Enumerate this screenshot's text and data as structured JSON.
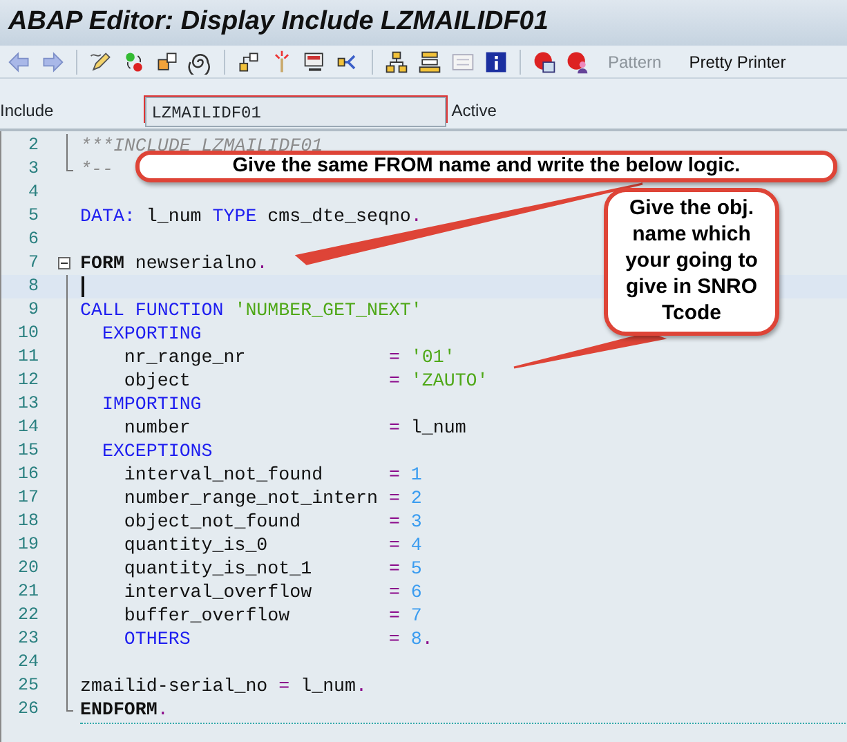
{
  "window": {
    "title": "ABAP Editor: Display Include LZMAILIDF01"
  },
  "toolbar": {
    "buttons": [
      {
        "label": "Pattern",
        "disabled": true
      },
      {
        "label": "Pretty Printer",
        "disabled": false
      }
    ]
  },
  "header": {
    "include_label": "Include",
    "include_value": "LZMAILIDF01",
    "status": "Active"
  },
  "editor": {
    "lines": [
      {
        "number": "2",
        "kind": "inner",
        "tokens": [
          {
            "kind": "comment",
            "text": "***INCLUDE LZMAILIDF01"
          }
        ]
      },
      {
        "number": "3",
        "kind": "end",
        "tokens": [
          {
            "kind": "comment",
            "text": "*--"
          }
        ]
      },
      {
        "number": "4",
        "kind": "plain"
      },
      {
        "number": "5",
        "kind": "plain",
        "tokens": [
          {
            "kind": "keyword",
            "text": "DATA:"
          },
          {
            "kind": "plain",
            "text": " l_num "
          },
          {
            "kind": "keyword",
            "text": "TYPE"
          },
          {
            "kind": "plain",
            "text": " cms_dte_seqno"
          },
          {
            "kind": "operator",
            "text": "."
          }
        ]
      },
      {
        "number": "6",
        "kind": "plain"
      },
      {
        "number": "7",
        "kind": "start",
        "tokens": [
          {
            "kind": "statement",
            "text": "FORM"
          },
          {
            "kind": "plain",
            "text": " newserialno"
          },
          {
            "kind": "operator",
            "text": "."
          }
        ]
      },
      {
        "number": "8",
        "kind": "inner",
        "current": true
      },
      {
        "number": "9",
        "kind": "inner",
        "tokens": [
          {
            "kind": "keyword",
            "text": "CALL FUNCTION"
          },
          {
            "kind": "string",
            "text": " 'NUMBER_GET_NEXT'"
          }
        ]
      },
      {
        "number": "10",
        "kind": "inner",
        "tokens": [
          {
            "kind": "keyword",
            "text": "  EXPORTING"
          }
        ]
      },
      {
        "number": "11",
        "kind": "inner",
        "tokens": [
          {
            "kind": "plain",
            "text": "    nr_range_nr             "
          },
          {
            "kind": "operator",
            "text": "="
          },
          {
            "kind": "string",
            "text": " '01'"
          }
        ]
      },
      {
        "number": "12",
        "kind": "inner",
        "tokens": [
          {
            "kind": "plain",
            "text": "    object                  "
          },
          {
            "kind": "operator",
            "text": "="
          },
          {
            "kind": "string",
            "text": " 'ZAUTO'"
          }
        ]
      },
      {
        "number": "13",
        "kind": "inner",
        "tokens": [
          {
            "kind": "keyword",
            "text": "  IMPORTING"
          }
        ]
      },
      {
        "number": "14",
        "kind": "inner",
        "tokens": [
          {
            "kind": "plain",
            "text": "    number                  "
          },
          {
            "kind": "operator",
            "text": "="
          },
          {
            "kind": "plain",
            "text": " l_num"
          }
        ]
      },
      {
        "number": "15",
        "kind": "inner",
        "tokens": [
          {
            "kind": "keyword",
            "text": "  EXCEPTIONS"
          }
        ]
      },
      {
        "number": "16",
        "kind": "inner",
        "tokens": [
          {
            "kind": "plain",
            "text": "    interval_not_found      "
          },
          {
            "kind": "operator",
            "text": "="
          },
          {
            "kind": "number",
            "text": " 1"
          }
        ]
      },
      {
        "number": "17",
        "kind": "inner",
        "tokens": [
          {
            "kind": "plain",
            "text": "    number_range_not_intern "
          },
          {
            "kind": "operator",
            "text": "="
          },
          {
            "kind": "number",
            "text": " 2"
          }
        ]
      },
      {
        "number": "18",
        "kind": "inner",
        "tokens": [
          {
            "kind": "plain",
            "text": "    object_not_found        "
          },
          {
            "kind": "operator",
            "text": "="
          },
          {
            "kind": "number",
            "text": " 3"
          }
        ]
      },
      {
        "number": "19",
        "kind": "inner",
        "tokens": [
          {
            "kind": "plain",
            "text": "    quantity_is_0           "
          },
          {
            "kind": "operator",
            "text": "="
          },
          {
            "kind": "number",
            "text": " 4"
          }
        ]
      },
      {
        "number": "20",
        "kind": "inner",
        "tokens": [
          {
            "kind": "plain",
            "text": "    quantity_is_not_1       "
          },
          {
            "kind": "operator",
            "text": "="
          },
          {
            "kind": "number",
            "text": " 5"
          }
        ]
      },
      {
        "number": "21",
        "kind": "inner",
        "tokens": [
          {
            "kind": "plain",
            "text": "    interval_overflow       "
          },
          {
            "kind": "operator",
            "text": "="
          },
          {
            "kind": "number",
            "text": " 6"
          }
        ]
      },
      {
        "number": "22",
        "kind": "inner",
        "tokens": [
          {
            "kind": "plain",
            "text": "    buffer_overflow         "
          },
          {
            "kind": "operator",
            "text": "="
          },
          {
            "kind": "number",
            "text": " 7"
          }
        ]
      },
      {
        "number": "23",
        "kind": "inner",
        "tokens": [
          {
            "kind": "keyword",
            "text": "    OTHERS"
          },
          {
            "kind": "operator",
            "text": "                  ="
          },
          {
            "kind": "number",
            "text": " 8"
          },
          {
            "kind": "operator",
            "text": "."
          }
        ]
      },
      {
        "number": "24",
        "kind": "inner"
      },
      {
        "number": "25",
        "kind": "inner",
        "tokens": [
          {
            "kind": "plain",
            "text": "zmailid-serial_no "
          },
          {
            "kind": "operator",
            "text": "="
          },
          {
            "kind": "plain",
            "text": " l_num"
          },
          {
            "kind": "operator",
            "text": "."
          }
        ]
      },
      {
        "number": "26",
        "kind": "end",
        "tokens": [
          {
            "kind": "statement",
            "text": "ENDFORM"
          },
          {
            "kind": "operator",
            "text": "."
          }
        ]
      }
    ]
  },
  "callouts": [
    {
      "text": "Give the same FROM name and write the below logic."
    },
    {
      "text": "Give the obj. name which your going to give in SNRO Tcode"
    }
  ]
}
